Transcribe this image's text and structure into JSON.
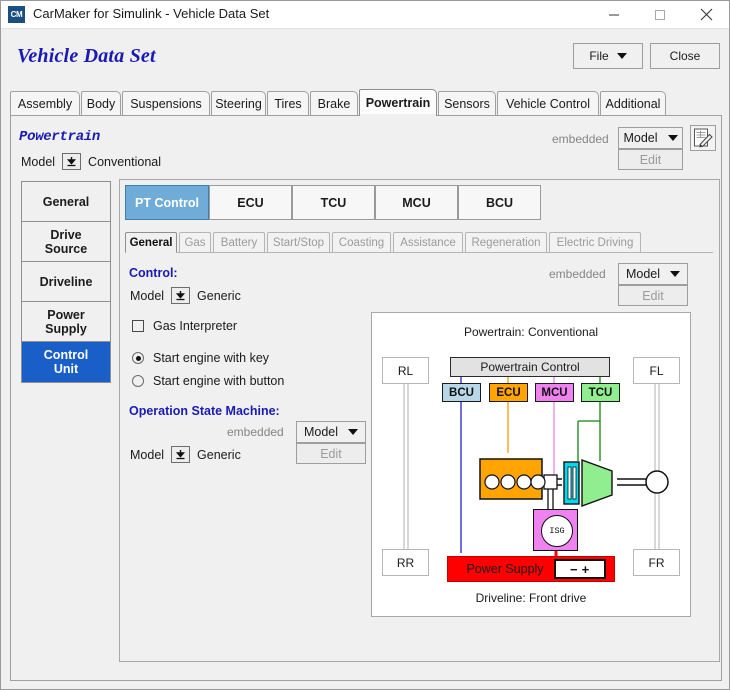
{
  "window": {
    "icon_label": "CM",
    "title": "CarMaker for Simulink - Vehicle Data Set",
    "controls": {
      "minimize": "minimize-icon",
      "maximize": "maximize-icon",
      "close": "close-icon"
    }
  },
  "header": {
    "title": "Vehicle Data Set",
    "file_button": "File",
    "close_button": "Close"
  },
  "main_tabs": [
    {
      "label": "Assembly",
      "active": false
    },
    {
      "label": "Body",
      "active": false
    },
    {
      "label": "Suspensions",
      "active": false
    },
    {
      "label": "Steering",
      "active": false
    },
    {
      "label": "Tires",
      "active": false
    },
    {
      "label": "Brake",
      "active": false
    },
    {
      "label": "Powertrain",
      "active": true
    },
    {
      "label": "Sensors",
      "active": false
    },
    {
      "label": "Vehicle Control",
      "active": false
    },
    {
      "label": "Additional",
      "active": false
    }
  ],
  "powertrain": {
    "section_title": "Powertrain",
    "model_label": "Model",
    "model_value": "Conventional",
    "embedded_label": "embedded",
    "combo_value": "Model",
    "edit_label": "Edit",
    "pencil_icon": "edit-document-icon"
  },
  "sidebar": {
    "items": [
      {
        "label": "General",
        "selected": false
      },
      {
        "label": "Drive\nSource",
        "selected": false
      },
      {
        "label": "Driveline",
        "selected": false
      },
      {
        "label": "Power\nSupply",
        "selected": false
      },
      {
        "label": "Control\nUnit",
        "selected": true
      }
    ]
  },
  "control_tabs": [
    {
      "label": "PT Control",
      "active": true
    },
    {
      "label": "ECU",
      "active": false
    },
    {
      "label": "TCU",
      "active": false
    },
    {
      "label": "MCU",
      "active": false
    },
    {
      "label": "BCU",
      "active": false
    }
  ],
  "sub_tabs": [
    {
      "label": "General",
      "active": true
    },
    {
      "label": "Gas",
      "active": false
    },
    {
      "label": "Battery",
      "active": false
    },
    {
      "label": "Start/Stop",
      "active": false
    },
    {
      "label": "Coasting",
      "active": false
    },
    {
      "label": "Assistance",
      "active": false
    },
    {
      "label": "Regeneration",
      "active": false
    },
    {
      "label": "Electric Driving",
      "active": false
    }
  ],
  "control_section": {
    "title": "Control:",
    "model_label": "Model",
    "model_value": "Generic",
    "embedded_label": "embedded",
    "combo_value": "Model",
    "edit_label": "Edit",
    "checkbox_label": "Gas Interpreter",
    "checkbox_checked": false,
    "radio_key": "Start engine with key",
    "radio_button": "Start engine with button",
    "radio_selected": "key"
  },
  "osm_section": {
    "title": "Operation State Machine:",
    "model_label": "Model",
    "model_value": "Generic",
    "embedded_label": "embedded",
    "combo_value": "Model",
    "edit_label": "Edit"
  },
  "diagram": {
    "top_caption": "Powertrain: Conventional",
    "bottom_caption": "Driveline: Front drive",
    "powertrain_control": "Powertrain Control",
    "power_supply": "Power Supply",
    "battery_minus": "−",
    "battery_plus": "+",
    "isg_label": "ISG",
    "wheels": {
      "rear_left": "RL",
      "front_left": "FL",
      "rear_right": "RR",
      "front_right": "FR"
    },
    "control_units": [
      {
        "label": "BCU",
        "color": "#b8d8e8",
        "line_color": "#2222cc"
      },
      {
        "label": "ECU",
        "color": "#ffa400",
        "line_color": "#ff9900"
      },
      {
        "label": "MCU",
        "color": "#ee82ee",
        "line_color": "#ee82ee"
      },
      {
        "label": "TCU",
        "color": "#90ee90",
        "line_color": "#118411"
      }
    ],
    "components": {
      "engine_color": "#ffa400",
      "clutch_color": "#00d8f0",
      "transmission_color": "#90ee90",
      "isg_color": "#ee82ee",
      "power_supply_color": "#fe0000"
    }
  },
  "colors": {
    "accent_blue": "#1a1ab4",
    "selected_sidebar": "#1a5fc8",
    "active_tab": "#6fadd8",
    "window_bg": "#f0f0f0"
  }
}
